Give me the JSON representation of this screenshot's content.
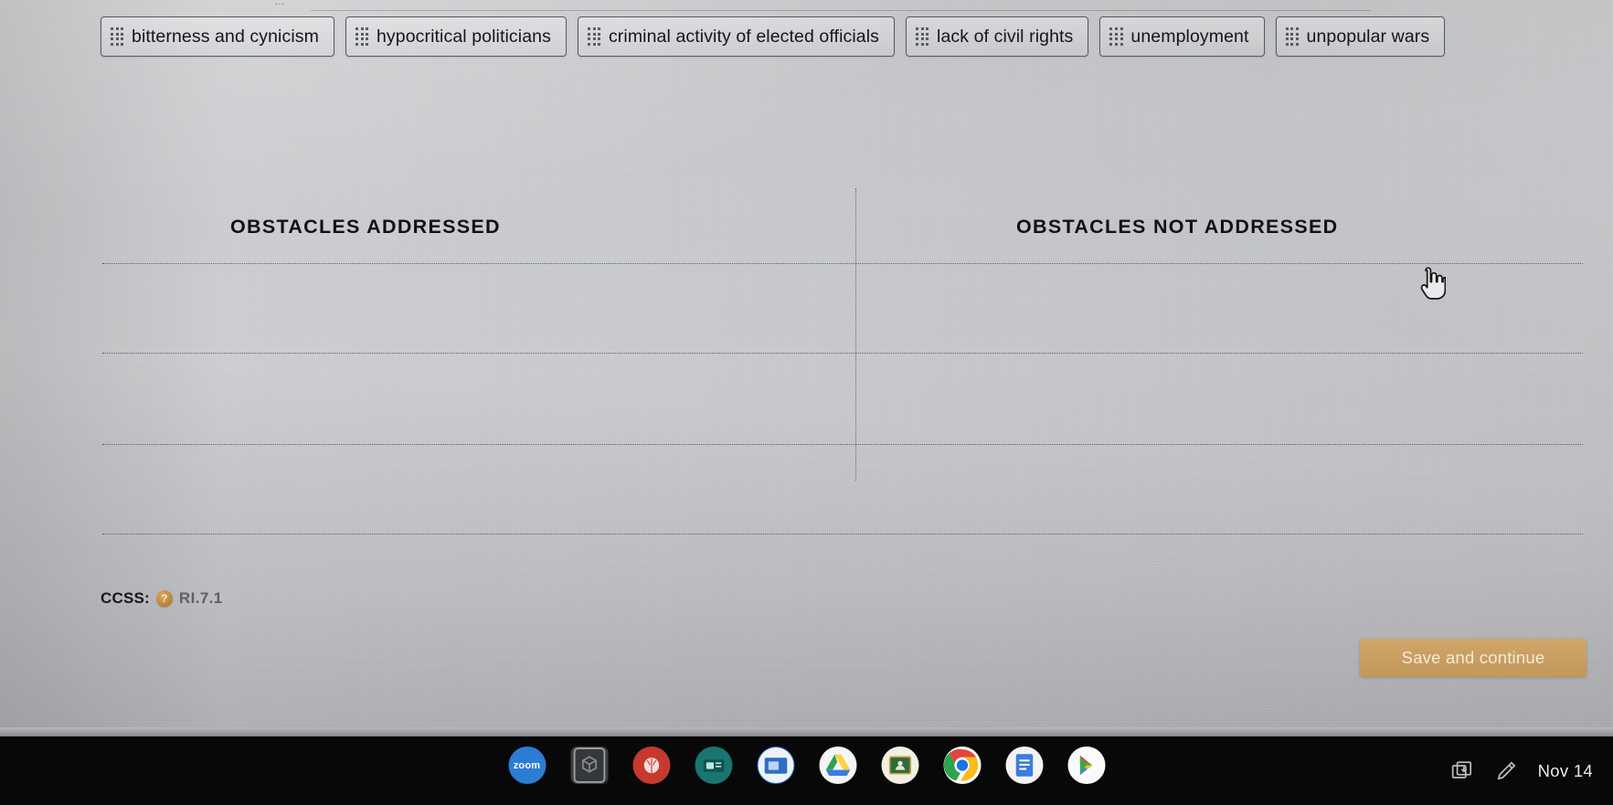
{
  "activity": {
    "top_fragment": "…",
    "chips": [
      {
        "label": "bitterness and cynicism",
        "handle_icon": "drag-handle-icon"
      },
      {
        "label": "hypocritical politicians",
        "handle_icon": "drag-handle-icon"
      },
      {
        "label": "criminal activity of elected officials",
        "handle_icon": "drag-handle-icon"
      },
      {
        "label": "lack of civil rights",
        "handle_icon": "drag-handle-icon"
      },
      {
        "label": "unemployment",
        "handle_icon": "drag-handle-icon"
      },
      {
        "label": "unpopular wars",
        "handle_icon": "drag-handle-icon"
      }
    ],
    "columns": [
      {
        "title": "OBSTACLES ADDRESSED",
        "items": []
      },
      {
        "title": "OBSTACLES NOT ADDRESSED",
        "items": []
      }
    ],
    "rows": 4
  },
  "footer": {
    "ccss_label": "CCSS:",
    "help_icon": "question-mark-icon",
    "help_glyph": "?",
    "standard_code": "RI.7.1",
    "save_label": "Save and continue",
    "save_color": "#c2975a"
  },
  "cursor": {
    "type": "pointing-hand-cursor"
  },
  "shelf": {
    "apps": [
      {
        "name": "zoom",
        "label": "zoom",
        "color": "#2b7cd3",
        "shape": "circle"
      },
      {
        "name": "files",
        "label": "",
        "color": "#3b3d41",
        "shape": "square"
      },
      {
        "name": "brainpop",
        "label": "",
        "color": "#c6392f",
        "shape": "circle"
      },
      {
        "name": "teal-app",
        "label": "",
        "color": "#19756f",
        "shape": "circle"
      },
      {
        "name": "blue-app",
        "label": "",
        "color": "#2d6fc4",
        "shape": "circle"
      },
      {
        "name": "google-drive",
        "label": "",
        "color": "#f4f4f4",
        "shape": "circle"
      },
      {
        "name": "classroom",
        "label": "",
        "color": "#f2f0e6",
        "shape": "circle"
      },
      {
        "name": "google-chrome",
        "label": "",
        "color": "#ffffff",
        "shape": "circle"
      },
      {
        "name": "google-docs",
        "label": "",
        "color": "#f4f4f4",
        "shape": "circle"
      },
      {
        "name": "play-store",
        "label": "",
        "color": "#ffffff",
        "shape": "circle"
      }
    ],
    "tray": {
      "screenshot_icon": "screen-capture-icon",
      "stylus_icon": "stylus-pen-icon",
      "clock": "Nov 14"
    }
  }
}
